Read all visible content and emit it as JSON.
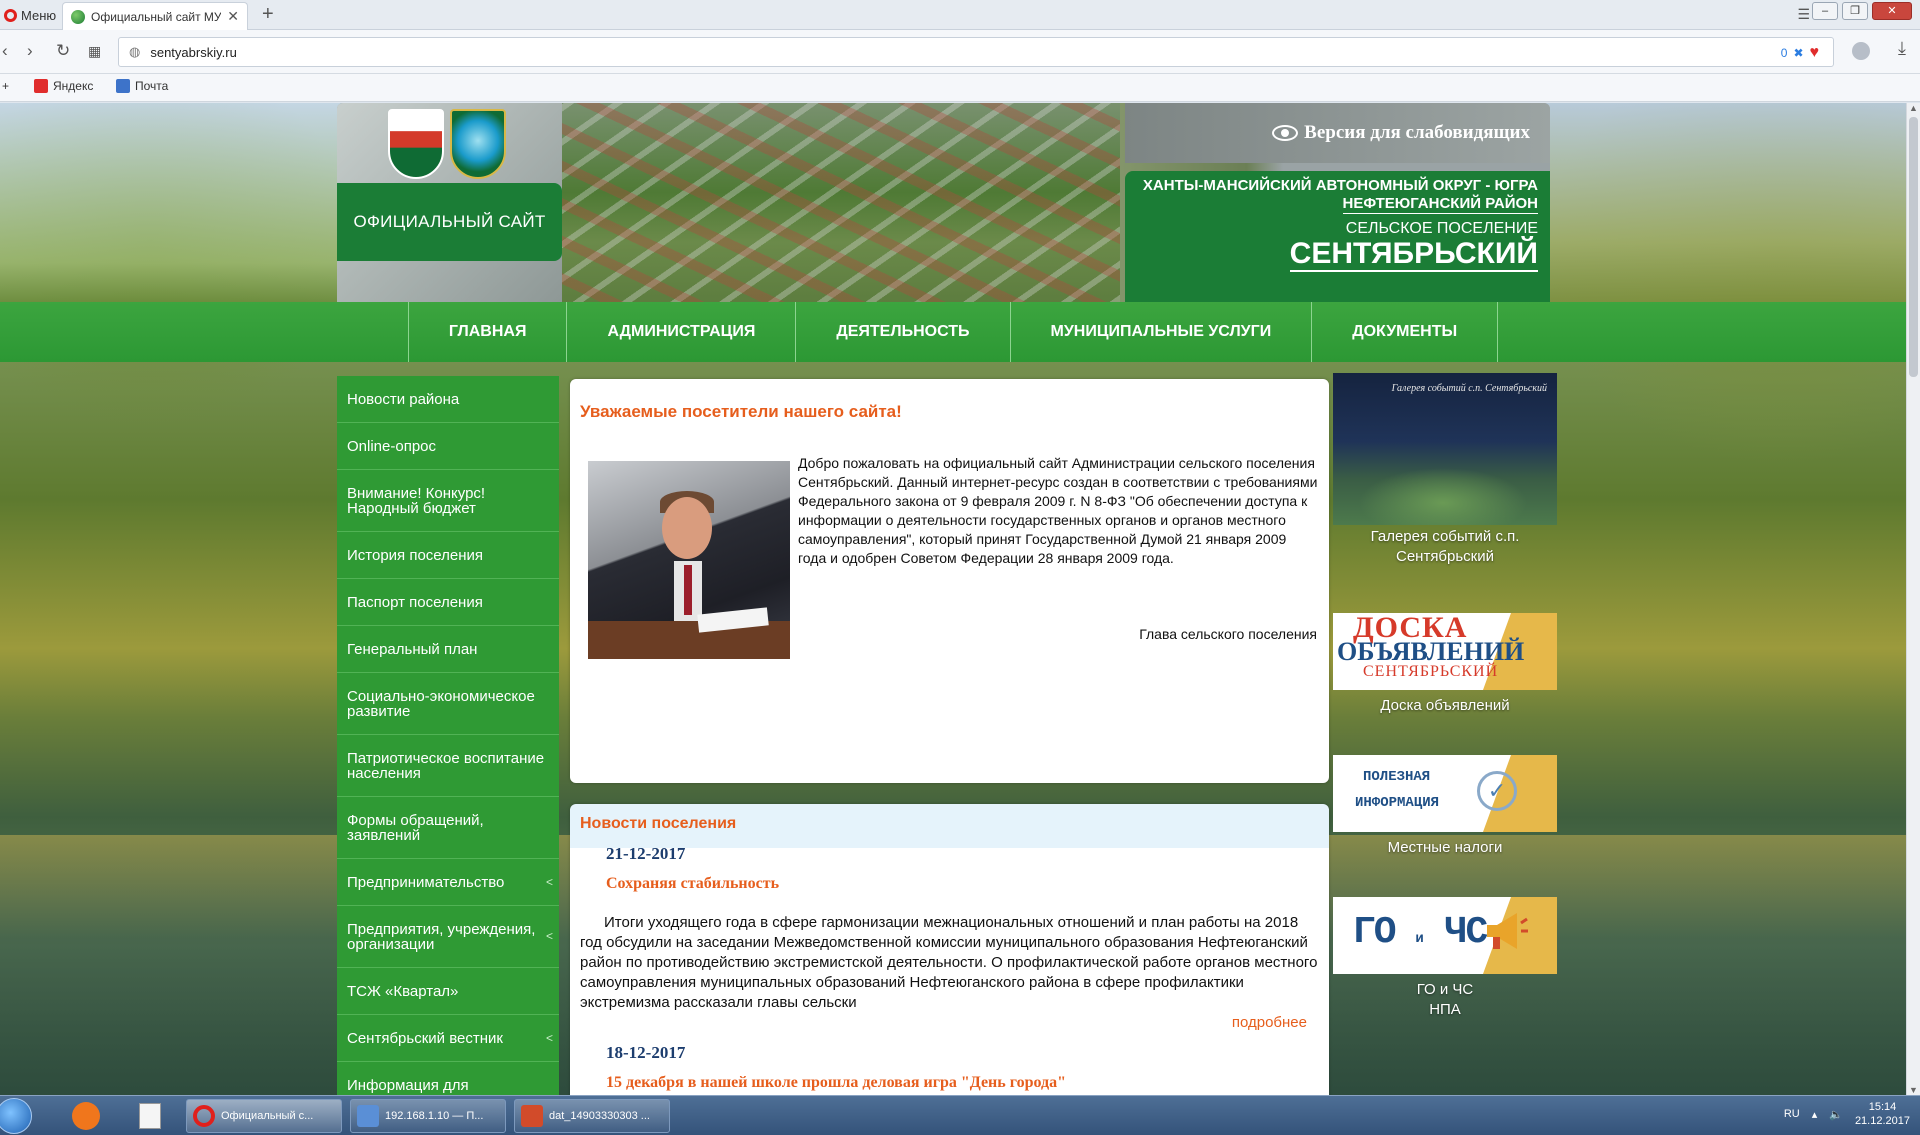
{
  "browser": {
    "menu_label": "Меню",
    "tab_title": "Официальный сайт МУ \"С",
    "url": "sentyabrskiy.ru",
    "counter": "0",
    "bookmarks": [
      "Яндекс",
      "Почта"
    ]
  },
  "header": {
    "official_label": "ОФИЦИАЛЬНЫЙ САЙТ",
    "low_vision_label": "Версия для слабовидящих",
    "region_line1": "ХАНТЫ-МАНСИЙСКИЙ АВТОНОМНЫЙ ОКРУГ - ЮГРА",
    "region_line2": "НЕФТЕЮГАНСКИЙ РАЙОН",
    "settlement_type": "СЕЛЬСКОЕ ПОСЕЛЕНИЕ",
    "settlement_name": "СЕНТЯБРЬСКИЙ"
  },
  "nav": {
    "items": [
      "ГЛАВНАЯ",
      "АДМИНИСТРАЦИЯ",
      "ДЕЯТЕЛЬНОСТЬ",
      "МУНИЦИПАЛЬНЫЕ УСЛУГИ",
      "ДОКУМЕНТЫ"
    ]
  },
  "left_menu": {
    "items": [
      {
        "label": "Новости района",
        "arrow": ""
      },
      {
        "label": "Online-опрос",
        "arrow": ""
      },
      {
        "label": "Внимание! Конкурс! Народный бюджет",
        "arrow": ""
      },
      {
        "label": "История поселения",
        "arrow": ""
      },
      {
        "label": "Паспорт поселения",
        "arrow": ""
      },
      {
        "label": "Генеральный план",
        "arrow": ""
      },
      {
        "label": "Социально-экономическое развитие",
        "arrow": ""
      },
      {
        "label": "Патриотическое воспитание населения",
        "arrow": ""
      },
      {
        "label": "Формы обращений, заявлений",
        "arrow": ""
      },
      {
        "label": "Предпринимательство",
        "arrow": "<"
      },
      {
        "label": "Предприятия, учреждения, организации",
        "arrow": "<"
      },
      {
        "label": "ТСЖ «Квартал»",
        "arrow": ""
      },
      {
        "label": "Сентябрьский вестник",
        "arrow": "<"
      },
      {
        "label": "Информация для",
        "arrow": ""
      }
    ]
  },
  "welcome": {
    "title": "Уважаемые посетители нашего сайта!",
    "text": "Добро пожаловать на официальный сайт Администрации сельского поселения Сентябрьский. Данный интернет-ресурс создан в соответствии с требованиями Федерального закона от 9 февраля 2009 г. N 8-ФЗ \"Об обеспечении доступа к информации о деятельности государственных органов и органов местного самоуправления\", который принят Государственной Думой 21 января 2009 года и одобрен Советом Федерации 28 января 2009 года.",
    "signature": "Глава сельского поселения"
  },
  "news": {
    "title": "Новости поселения",
    "items": [
      {
        "date": "21-12-2017",
        "headline": "Сохраняя стабильность",
        "text": "Итоги уходящего года в сфере гармонизации межнациональных отношений и план работы на 2018 год обсудили на заседании Межведомственной комиссии муниципального образования Нефтеюганский район по противодействию экстремистской деятельности. О профилактической работе органов местного самоуправления муниципальных образований Нефтеюганского района в сфере профилактики экстремизма рассказали главы сельски",
        "more": "подробнее"
      },
      {
        "date": "18-12-2017",
        "headline": "15 декабря в нашей школе прошла деловая игра \"День города\""
      }
    ]
  },
  "right_col": {
    "gallery_overlay": "Галерея событий с.п. Сентябрьский",
    "gallery_caption": "Галерея событий с.п. Сентябрьский",
    "board_line1": "ДОСКА",
    "board_line2": "ОБЪЯВЛЕНИЙ",
    "board_line3": "СЕНТЯБРЬСКИЙ",
    "board_caption": "Доска объявлений",
    "useful_line1": "ПОЛЕЗНАЯ",
    "useful_line2": "ИНФОРМАЦИЯ",
    "useful_caption": "Местные налоги",
    "go_main": "ГО",
    "go_and": "и",
    "go_cs": "ЧС",
    "go_caption_1": "ГО и ЧС",
    "go_caption_2": "НПА"
  },
  "taskbar": {
    "tasks": [
      "Официальный с...",
      "192.168.1.10 — П...",
      "dat_14903330303 ..."
    ],
    "lang": "RU",
    "time": "15:14",
    "date": "21.12.2017"
  },
  "colors": {
    "brand_green": "#2f9a34",
    "accent_orange": "#e65e1d",
    "date_blue": "#1c3d6e"
  }
}
